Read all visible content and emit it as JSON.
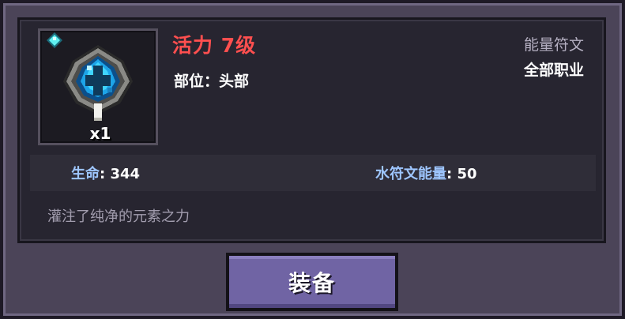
{
  "item": {
    "name": "活力 7级",
    "quantity": "x1",
    "slot": "部位：头部",
    "category": "能量符文",
    "class_req": "全部职业",
    "icon": "water-rune-icon",
    "rarity_icon": "diamond-gem-icon"
  },
  "stats": [
    {
      "label": "生命",
      "value": ": 344"
    },
    {
      "label": "水符文能量",
      "value": ": 50"
    }
  ],
  "description": "灌注了纯净的元素之力",
  "actions": {
    "equip_label": "装备"
  },
  "colors": {
    "title": "#ff4f4f",
    "stat_label": "#9ec6ff",
    "button": "#7064a4",
    "panel": "#272530"
  }
}
